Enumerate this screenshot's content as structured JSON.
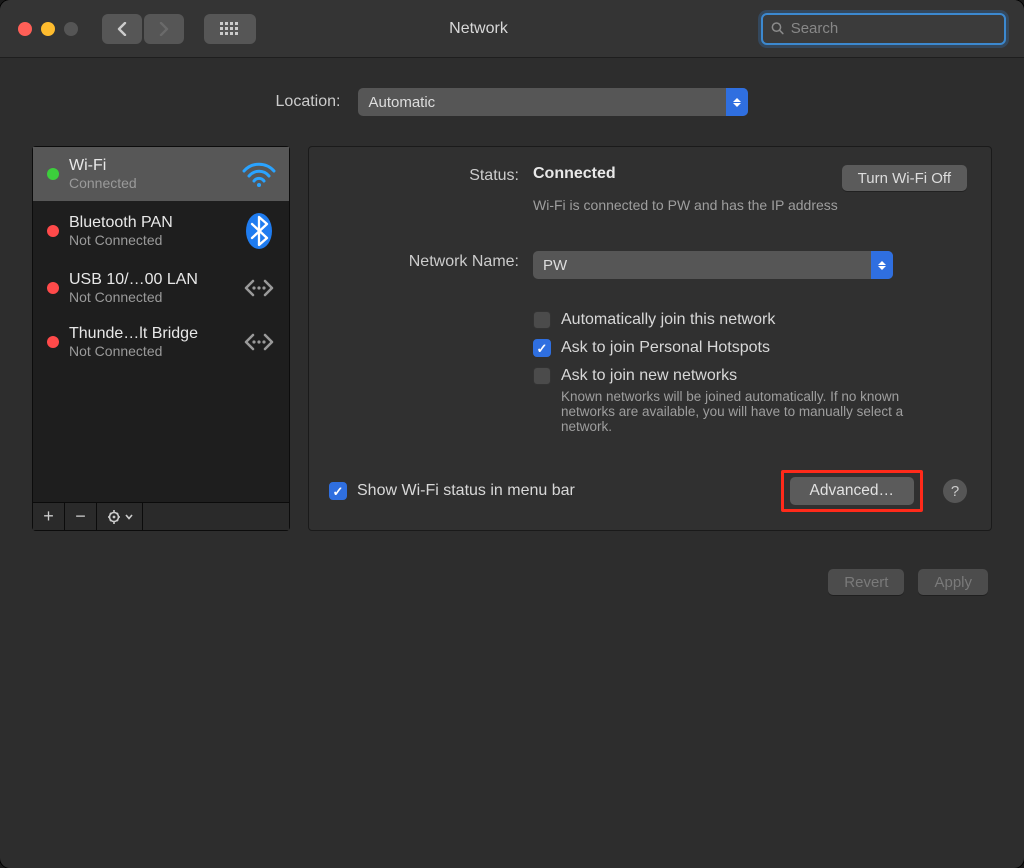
{
  "title": "Network",
  "search_placeholder": "Search",
  "location_label": "Location:",
  "location_value": "Automatic",
  "services": [
    {
      "name": "Wi-Fi",
      "status": "Connected",
      "dot": "green",
      "icon": "wifi",
      "selected": true
    },
    {
      "name": "Bluetooth PAN",
      "status": "Not Connected",
      "dot": "red",
      "icon": "bluetooth",
      "selected": false
    },
    {
      "name": "USB 10/…00 LAN",
      "status": "Not Connected",
      "dot": "red",
      "icon": "dots",
      "selected": false
    },
    {
      "name": "Thunde…lt Bridge",
      "status": "Not Connected",
      "dot": "red",
      "icon": "dots",
      "selected": false
    }
  ],
  "detail": {
    "status_label": "Status:",
    "status_value": "Connected",
    "wifi_toggle": "Turn Wi-Fi Off",
    "status_sub": "Wi-Fi is connected to PW and has the IP address",
    "netname_label": "Network Name:",
    "netname_value": "PW",
    "cb_autojoin": "Automatically join this network",
    "cb_autojoin_checked": false,
    "cb_hotspot": "Ask to join Personal Hotspots",
    "cb_hotspot_checked": true,
    "cb_newnet": "Ask to join new networks",
    "cb_newnet_checked": false,
    "known_note": "Known networks will be joined automatically. If no known networks are available, you will have to manually select a network.",
    "show_menubar": "Show Wi-Fi status in menu bar",
    "show_menubar_checked": true,
    "advanced": "Advanced…",
    "help": "?"
  },
  "footer": {
    "revert": "Revert",
    "apply": "Apply"
  }
}
